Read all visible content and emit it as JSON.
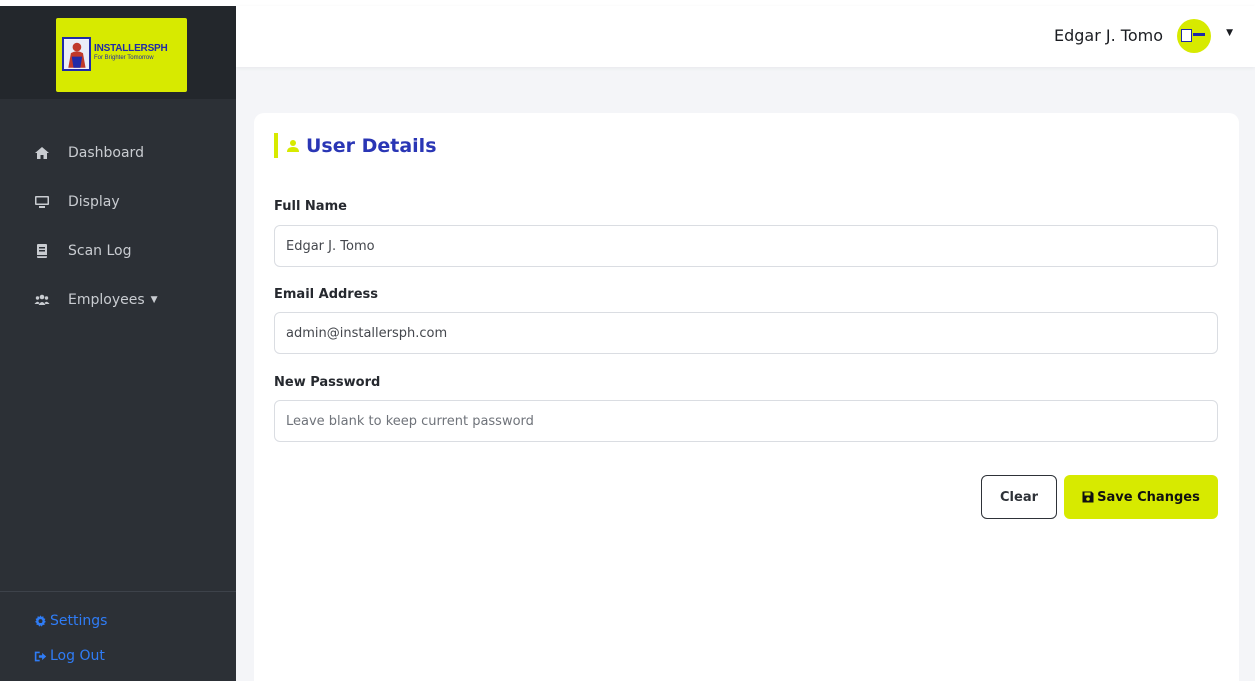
{
  "brand": {
    "logo_title": "INSTALLERSPH",
    "logo_subtitle": "For Brighter Tomorrow",
    "accent_color": "#d7ea00",
    "brand_blue": "#1f2aa8"
  },
  "sidebar": {
    "items": [
      {
        "label": "Dashboard",
        "icon": "home-icon"
      },
      {
        "label": "Display",
        "icon": "monitor-icon"
      },
      {
        "label": "Scan Log",
        "icon": "book-icon"
      },
      {
        "label": "Employees",
        "icon": "users-icon",
        "has_dropdown": true
      }
    ],
    "footer": {
      "settings_label": "Settings",
      "logout_label": "Log Out",
      "link_color": "#2f7cf6"
    }
  },
  "header": {
    "user_name": "Edgar J. Tomo"
  },
  "card": {
    "title": "User Details",
    "full_name_label": "Full Name",
    "full_name_value": "Edgar J. Tomo",
    "email_label": "Email Address",
    "email_value": "admin@installersph.com",
    "password_label": "New Password",
    "password_placeholder": "Leave blank to keep current password",
    "clear_label": "Clear",
    "save_label": "Save Changes"
  }
}
